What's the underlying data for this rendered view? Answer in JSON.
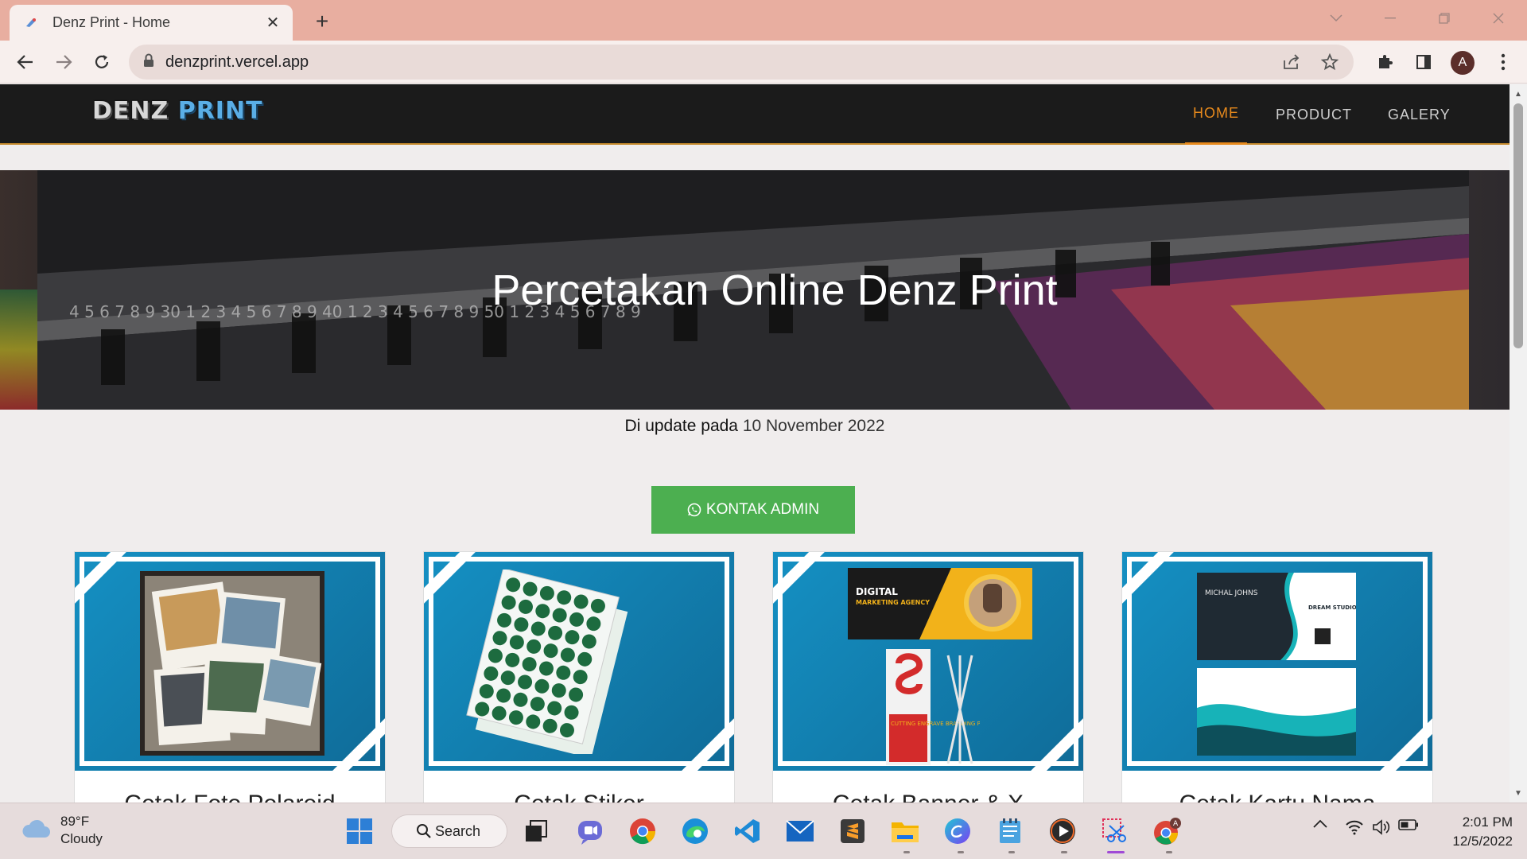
{
  "browser": {
    "tab_title": "Denz Print - Home",
    "url": "denzprint.vercel.app",
    "profile_initial": "A"
  },
  "site": {
    "logo_part1": "DENZ",
    "logo_part2": "PRINT",
    "nav": [
      {
        "label": "HOME",
        "active": true
      },
      {
        "label": "PRODUCT",
        "active": false
      },
      {
        "label": "GALERY",
        "active": false
      }
    ],
    "hero_title": "Percetakan Online Denz Print",
    "update_prefix": "Di update pada",
    "update_date": "10 November 2022",
    "cta_label": "KONTAK ADMIN",
    "products": [
      {
        "title": "Cetak Foto Polaroid"
      },
      {
        "title": "Cetak Stiker"
      },
      {
        "title": "Cetak Banner & X"
      },
      {
        "title": "Cetak Kartu Nama"
      }
    ],
    "thumb_text": {
      "banner_line1": "DIGITAL",
      "banner_line2": "MARKETING AGENCY",
      "standee_line": "CUTTING ENGRAVE BRANDING PRINTING DESIGN",
      "card_name": "MICHAL JOHNS",
      "card_brand": "DREAM STUDIO"
    }
  },
  "taskbar": {
    "weather_temp": "89°F",
    "weather_desc": "Cloudy",
    "search_label": "Search",
    "time": "2:01 PM",
    "date": "12/5/2022"
  },
  "colors": {
    "tabbar": "#e8aea0",
    "nav_active": "#e88a1c",
    "cta": "#4caf50",
    "card_bg": "#1590c3"
  }
}
